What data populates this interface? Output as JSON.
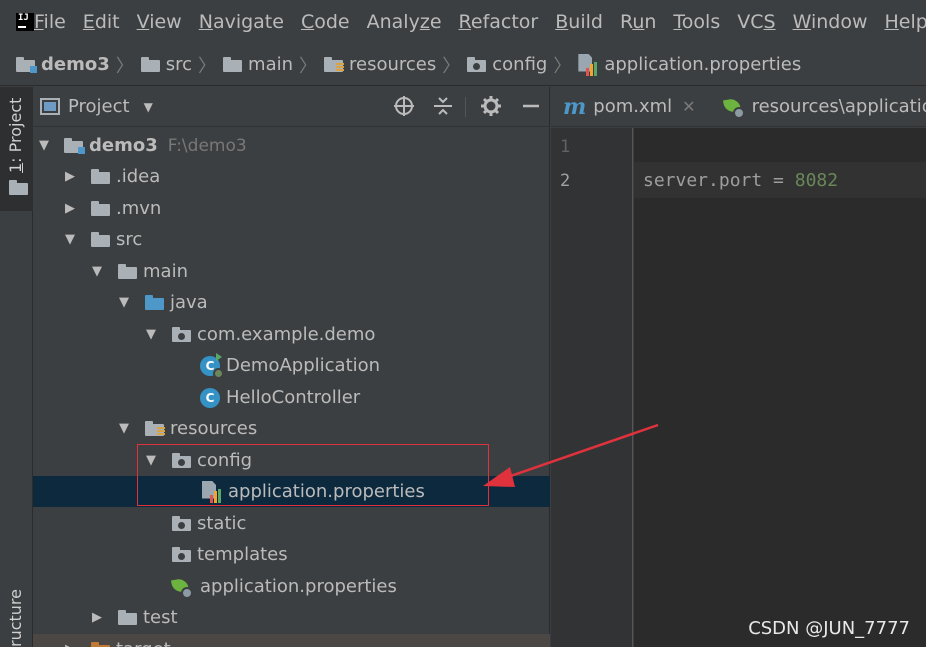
{
  "menu": {
    "items": [
      {
        "mn": "F",
        "rest": "ile"
      },
      {
        "mn": "E",
        "rest": "dit"
      },
      {
        "mn": "V",
        "rest": "iew"
      },
      {
        "mn": "N",
        "rest": "avigate"
      },
      {
        "mn": "C",
        "rest": "ode"
      },
      {
        "pre": "Analy",
        "mn": "z",
        "rest": "e"
      },
      {
        "mn": "R",
        "rest": "efactor"
      },
      {
        "mn": "B",
        "rest": "uild"
      },
      {
        "pre": "R",
        "mn": "u",
        "rest": "n"
      },
      {
        "mn": "T",
        "rest": "ools"
      },
      {
        "pre": "VC",
        "mn": "S",
        "rest": ""
      },
      {
        "mn": "W",
        "rest": "indow"
      },
      {
        "mn": "H",
        "rest": "elp"
      }
    ]
  },
  "breadcrumb": {
    "items": [
      "demo3",
      "src",
      "main",
      "resources",
      "config",
      "application.properties"
    ]
  },
  "toolstrip": {
    "project_num": "1",
    "project_label": ": Project",
    "structure_label": "ructure"
  },
  "panel": {
    "title": "Project",
    "caret": "▼"
  },
  "tree": {
    "root_name": "demo3",
    "root_path": "F:\\demo3",
    "idea": ".idea",
    "mvn": ".mvn",
    "src": "src",
    "main": "main",
    "java": "java",
    "package": "com.example.demo",
    "demo_app": "DemoApplication",
    "hello_controller": "HelloController",
    "resources": "resources",
    "config": "config",
    "config_props": "application.properties",
    "static": "static",
    "templates": "templates",
    "res_props": "application.properties",
    "test": "test",
    "target": "target"
  },
  "editor": {
    "tab1": "pom.xml",
    "tab2": "resources\\application",
    "line1": "1",
    "line2": "2",
    "code_key": "server.port",
    "code_op": " = ",
    "code_value": "8082"
  },
  "watermark": "CSDN @JUN_7777",
  "colors": {
    "highlight_box": "#e0323c",
    "selection": "#0d293e"
  }
}
